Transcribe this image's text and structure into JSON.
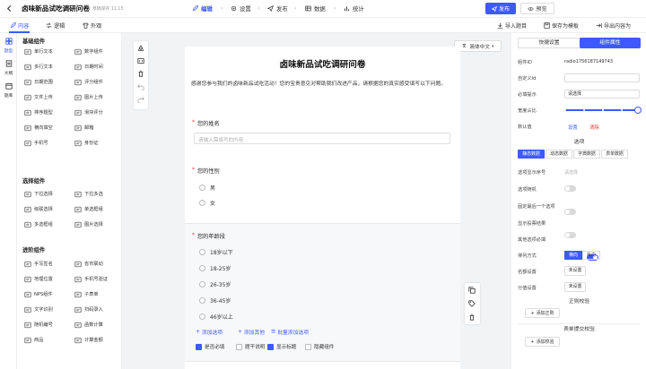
{
  "header": {
    "title": "卤味新品试吃调研问卷",
    "saved": "草稿保存 11:15",
    "steps": [
      {
        "label": "编辑",
        "active": true
      },
      {
        "label": "设置",
        "active": false
      },
      {
        "label": "发布",
        "active": false
      },
      {
        "label": "数据",
        "active": false
      },
      {
        "label": "统计",
        "active": false
      }
    ],
    "publish": "发布",
    "preview": "预览"
  },
  "subbar": {
    "tabs": [
      "内容",
      "逻辑",
      "外观"
    ],
    "actions": [
      "导入题目",
      "保存为模板",
      "导出内容为"
    ]
  },
  "leftrail": [
    "题型",
    "大纲",
    "题库"
  ],
  "components": {
    "basic_title": "基础组件",
    "basic": [
      {
        "label": "单行文本",
        "icon": "single-line-icon"
      },
      {
        "label": "数字组件",
        "icon": "number-icon"
      },
      {
        "label": "多行文本",
        "icon": "multi-line-icon"
      },
      {
        "label": "日期时间",
        "icon": "datetime-icon"
      },
      {
        "label": "日期范围",
        "icon": "date-range-icon"
      },
      {
        "label": "评分组件",
        "icon": "rating-icon"
      },
      {
        "label": "文件上传",
        "icon": "file-upload-icon"
      },
      {
        "label": "图片上传",
        "icon": "image-upload-icon"
      },
      {
        "label": "排序题型",
        "icon": "sort-icon"
      },
      {
        "label": "滑块评分",
        "icon": "slider-icon"
      },
      {
        "label": "横向填空",
        "icon": "fill-blank-icon"
      },
      {
        "label": "邮箱",
        "icon": "email-icon"
      },
      {
        "label": "手机号",
        "icon": "phone-icon"
      },
      {
        "label": "身份证",
        "icon": "id-card-icon"
      }
    ],
    "choice_title": "选择组件",
    "choice": [
      {
        "label": "下拉选择",
        "icon": "dropdown-icon"
      },
      {
        "label": "下拉多选",
        "icon": "dropdown-multi-icon"
      },
      {
        "label": "级联选择",
        "icon": "cascade-icon"
      },
      {
        "label": "单选框组",
        "icon": "radio-group-icon"
      },
      {
        "label": "多选框组",
        "icon": "checkbox-group-icon"
      },
      {
        "label": "图片选择",
        "icon": "image-select-icon"
      }
    ],
    "advanced_title": "进阶组件",
    "advanced": [
      {
        "label": "手写签名",
        "icon": "signature-icon"
      },
      {
        "label": "省市联动",
        "icon": "region-icon"
      },
      {
        "label": "地理位置",
        "icon": "location-icon"
      },
      {
        "label": "手机号验证",
        "icon": "phone-verify-icon"
      },
      {
        "label": "NPS组件",
        "icon": "nps-icon"
      },
      {
        "label": "子表单",
        "icon": "subform-icon"
      },
      {
        "label": "文字识别",
        "icon": "ocr-icon"
      },
      {
        "label": "扫码录入",
        "icon": "scan-icon"
      },
      {
        "label": "随机编号",
        "icon": "random-id-icon"
      },
      {
        "label": "函数计算",
        "icon": "function-icon"
      },
      {
        "label": "商品",
        "icon": "product-icon"
      },
      {
        "label": "计算金额",
        "icon": "amount-icon"
      }
    ]
  },
  "canvas": {
    "lang": "简体中文",
    "form_title": "卤味新品试吃调研问卷",
    "intro": "感谢您参与我们的卤味新品试吃活动！您的宝贵意见对帮助我们改进产品，请根据您的真实感受填写以下问题。",
    "q1": {
      "label": "您的姓名",
      "placeholder": "请输入需填写的内容"
    },
    "q2": {
      "label": "您的性别",
      "options": [
        "男",
        "女"
      ]
    },
    "q3": {
      "label": "您的年龄段",
      "options": [
        "18岁以下",
        "18-25岁",
        "26-35岁",
        "36-45岁",
        "46岁以上"
      ]
    },
    "add_option": "添加选项",
    "add_other": "添加其他",
    "batch_add": "批量添加选项",
    "toggles": [
      {
        "label": "是否必填",
        "on": true
      },
      {
        "label": "题干说明",
        "on": false
      },
      {
        "label": "显示标题",
        "on": true
      },
      {
        "label": "隐藏组件",
        "on": false
      }
    ]
  },
  "right": {
    "tabs": [
      "快捷设置",
      "组件属性"
    ],
    "component_id_label": "组件ID",
    "component_id": "radio1756187149743",
    "custom_id_label": "自定义Id",
    "hint_label": "必填提示",
    "hint_value": "请选择",
    "width_label": "宽度占比",
    "width_value": 100,
    "default_label": "默认值",
    "default_set": "设置",
    "default_clear": "清除",
    "options_title": "选项",
    "data_tabs": [
      "静态数据",
      "动态数据",
      "字典数据",
      "表单数据"
    ],
    "rows": [
      {
        "label": "选项显示序号",
        "type": "input",
        "value": "请选择"
      },
      {
        "label": "选项随机",
        "type": "switch",
        "on": false
      },
      {
        "label": "固定最后一个选项",
        "type": "switch",
        "on": false
      },
      {
        "label": "显示投票结果",
        "type": "switch",
        "on": false
      },
      {
        "label": "其他选项必填",
        "type": "switch",
        "on": true
      },
      {
        "label": "排列方式",
        "type": "seg",
        "options": [
          "横向",
          "纵向"
        ],
        "active": 0
      },
      {
        "label": "名额设置",
        "type": "button",
        "value": "未设置"
      },
      {
        "label": "分值设置",
        "type": "button",
        "value": "未设置"
      }
    ],
    "regex_title": "正则校验",
    "add_regex": "添加正则",
    "submit_title": "表单提交校验",
    "add_validate": "添加校验"
  }
}
